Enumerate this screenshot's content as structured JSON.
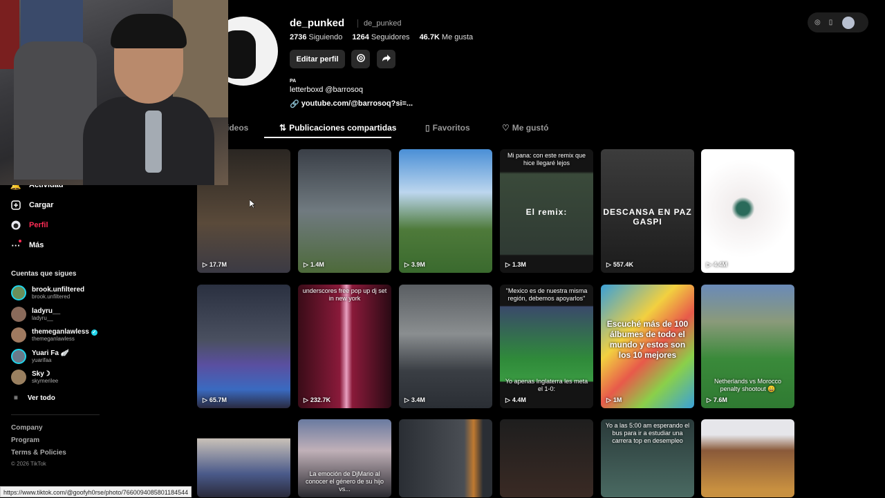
{
  "profile": {
    "username": "de_punked",
    "nickname": "de_punked",
    "following_count": "2736",
    "following_label": "Siguiendo",
    "followers_count": "1264",
    "followers_label": "Seguidores",
    "likes_count": "46.7K",
    "likes_label": "Me gusta",
    "edit_label": "Editar perfil",
    "bio_line1": "PA",
    "bio_line2": "letterboxd @barrosoq",
    "link": "youtube.com/@barrosoq?si=..."
  },
  "tabs": [
    {
      "label": "ideos",
      "icon": "videos-icon"
    },
    {
      "label": "Publicaciones compartidas",
      "icon": "repost-icon"
    },
    {
      "label": "Favoritos",
      "icon": "bookmark-icon"
    },
    {
      "label": "Me gustó",
      "icon": "heart-icon"
    }
  ],
  "sidebar": {
    "items": [
      {
        "label": "Actividad",
        "icon": "bell-icon"
      },
      {
        "label": "Cargar",
        "icon": "plus-square-icon"
      },
      {
        "label": "Perfil",
        "icon": "profile-avatar-icon"
      },
      {
        "label": "Más",
        "icon": "more-dots-icon"
      }
    ],
    "following_title": "Cuentas que sigues",
    "accounts": [
      {
        "name": "brook.unfiltered",
        "handle": "brook.unfiltered",
        "color": "#6a8f5a"
      },
      {
        "name": "ladyru__",
        "handle": "ladyru__",
        "color": "#8a6a5a"
      },
      {
        "name": "themeganlawless",
        "handle": "themeganlawless",
        "color": "#a07a60",
        "verified": true
      },
      {
        "name": "Yuari Fa 🪽",
        "handle": "yuarifaa",
        "color": "#6a7a8a"
      },
      {
        "name": "Sky☽",
        "handle": "skymerilee",
        "color": "#9a8060"
      }
    ],
    "see_all": "Ver todo",
    "footer": [
      "Company",
      "Program",
      "Terms & Policies"
    ],
    "copyright": "© 2026 TikTok"
  },
  "grid": [
    {
      "views": "17.7M",
      "bg": "linear-gradient(180deg,#2a2622,#5a4a3a 60%,#3b3a44)",
      "pinned": true
    },
    {
      "views": "1.4M",
      "bg": "linear-gradient(180deg,#3a3f47,#707a80 50%,#4d6a3a)"
    },
    {
      "views": "3.9M",
      "bg": "linear-gradient(180deg,#4a8fd6 0%,#bcd6ee 35%,#4e7a3a 65%,#3a6a2e)"
    },
    {
      "views": "1.3M",
      "bg": "linear-gradient(180deg,#141414 0%,#141414 18%,#3a4a3a 20%,#2f3a33 85%,#141414 86%)",
      "top_caption": "Mi pana: con este remix que hice llegaré lejos",
      "mid_caption": "El remix:"
    },
    {
      "views": "557.4K",
      "bg": "linear-gradient(180deg,#3c3c3c,#1c1c1c)",
      "mid_caption": "DESCANSA EN PAZ GASPI"
    },
    {
      "views": "4.4M",
      "bg": "radial-gradient(circle at 45% 48%,#2a6a5a 0%,#2a6a5a 8%,#f2eeee 14%,#ffffff 60%)"
    },
    {
      "views": "65.7M",
      "bg": "linear-gradient(180deg,#2a3040 0%,#4a5060 45%,#5a4fa0 65%,#3a6ac0 85%,#2a2a40)"
    },
    {
      "views": "232.7K",
      "bg": "linear-gradient(90deg,#3a0c18 0%,#8a1a3a 45%,#e8a0c0 52%,#8a1a3a 58%,#2a0a14 100%)",
      "top_caption": "underscores free pop up dj set in new york"
    },
    {
      "views": "3.4M",
      "bg": "linear-gradient(180deg,#5a5e62 0%,#8a8e90 40%,#3a3e44 70%,#2a2e34)"
    },
    {
      "views": "4.4M",
      "bg": "linear-gradient(180deg,#141414 0%,#141414 17%,#3a4a6a 18%,#2f8a3a 60%,#3a9a42 78%,#141414 79%)",
      "top_caption": "\"Mexico es de nuestra misma región, debemos apoyarlos\"",
      "bottom_caption": "Yo apenas Inglaterra les meta el 1-0:"
    },
    {
      "views": "1M",
      "bg": "linear-gradient(135deg,#3aa0d8 0%,#f2d040 35%,#e85a4a 55%,#8ad04a 75%,#3aa0d8)",
      "big_caption": "Escuché más de 100 álbumes de todo el mundo y estos son los 10 mejores"
    },
    {
      "views": "7.6M",
      "bg": "linear-gradient(180deg,#6a8ab8 0%,#8a9a7a 30%,#3a8a3a 60%,#2f7a32)",
      "bottom_caption": "Netherlands vs Morocco penalty shootout 😄"
    },
    {
      "views": "",
      "bg": "linear-gradient(180deg,#000 0%,#000 24%,#c8c0b8 25%,#4a5a8a 70%,#2a2a3a)"
    },
    {
      "views": "",
      "bg": "linear-gradient(180deg,#6a7aa0 0%,#c0b0b8 40%,#2a2a30)",
      "bottom_caption": "La emoción de DjMario al conocer el género de su hijo vs..."
    },
    {
      "views": "",
      "bg": "linear-gradient(90deg,#2a2e34 0%,#4a4e54 70%,#c07a30 80%,#2a2e34 90%)"
    },
    {
      "views": "",
      "bg": "linear-gradient(180deg,#1e1e1e,#3a2a24)"
    },
    {
      "views": "",
      "bg": "linear-gradient(180deg,#2a3a3a,#4a6a62)",
      "top_caption": "Yo a las 5:00 am esperando el bus para ir a estudiar una carrera top en desempleo"
    },
    {
      "views": "",
      "bg": "linear-gradient(180deg,#e6e6ea 0%,#e6e6ea 20%,#8a5a3a 40%,#c89040 90%)"
    }
  ],
  "status_url": "https://www.tiktok.com/@goofyh0rse/photo/7660094085801184544"
}
